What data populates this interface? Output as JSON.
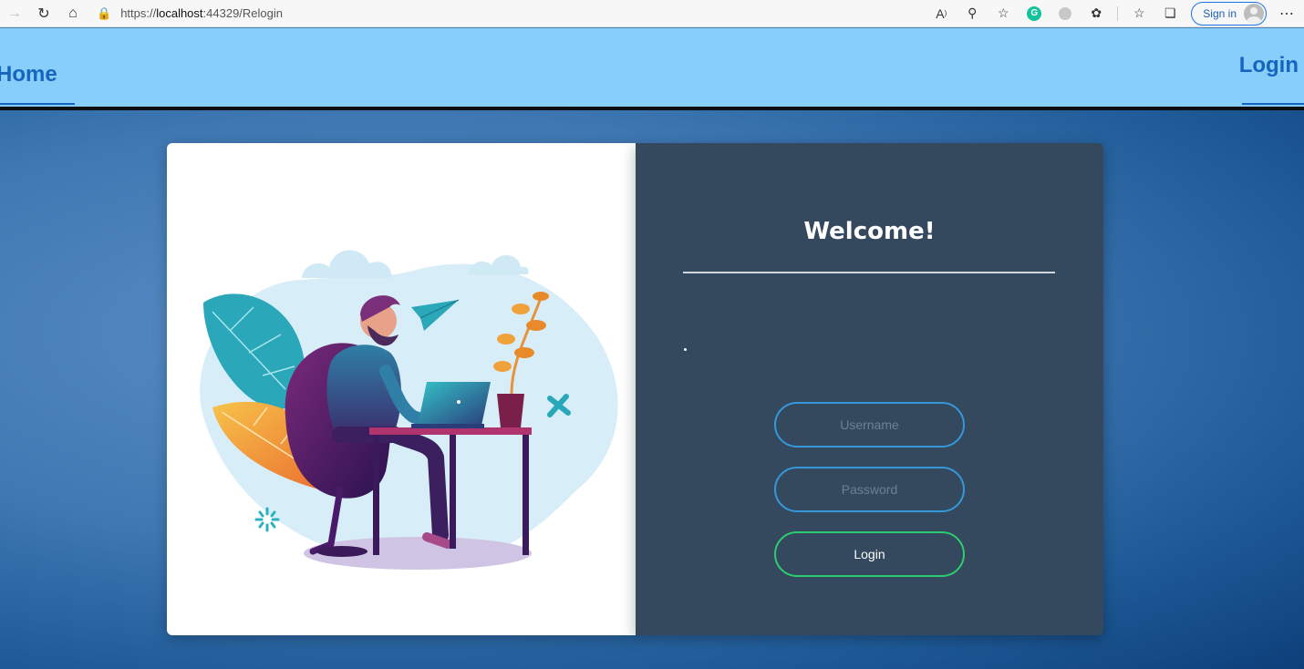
{
  "browser": {
    "url_prefix": "https://",
    "url_host": "localhost",
    "url_rest": ":44329/Relogin",
    "signin_label": "Sign in",
    "icons": [
      "back-icon",
      "refresh-icon",
      "home-icon",
      "lock-icon",
      "read-aloud-icon",
      "zoom-icon",
      "favorite-add-icon",
      "grammarly-icon",
      "extension-icon",
      "extensions-icon",
      "favorites-icon",
      "collections-icon",
      "profile-icon",
      "more-icon"
    ]
  },
  "nav": {
    "home_label": "Home",
    "login_label": "Login",
    "background": "#87cefa",
    "link_color": "#1565c0"
  },
  "login": {
    "heading": "Welcome!",
    "username_placeholder": "Username",
    "password_placeholder": "Password",
    "submit_label": "Login",
    "panel_color": "#34495e",
    "input_border": "#3498db",
    "button_border": "#2ecc71"
  },
  "illustration": {
    "subject": "person-working-on-laptop"
  }
}
